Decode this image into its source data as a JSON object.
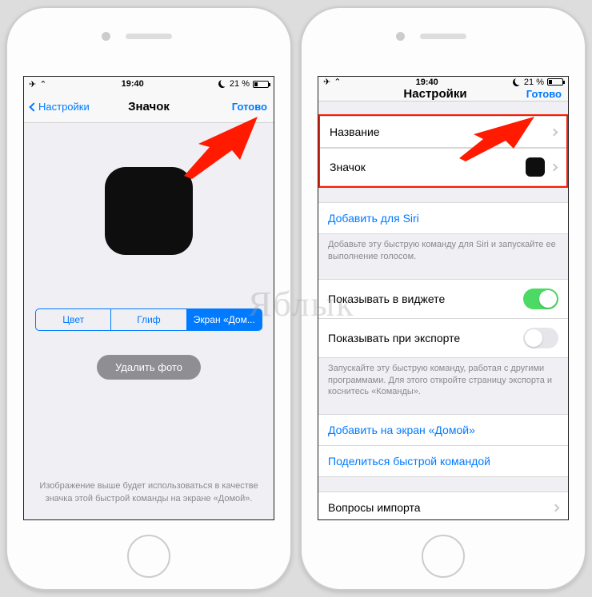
{
  "statusbar": {
    "time": "19:40",
    "battery": "21 %"
  },
  "left": {
    "nav": {
      "back": "Настройки",
      "title": "Значок",
      "done": "Готово"
    },
    "seg": {
      "color": "Цвет",
      "glyph": "Глиф",
      "home": "Экран «Дом..."
    },
    "delete": "Удалить фото",
    "note": "Изображение выше будет использоваться в качестве значка этой быстрой команды на экране «Домой»."
  },
  "right": {
    "nav": {
      "title": "Настройки",
      "done": "Готово"
    },
    "rows": {
      "name": "Название",
      "icon": "Значок",
      "addSiri": "Добавить для Siri",
      "siriNote": "Добавьте эту быструю команду для Siri и запускайте ее выполнение голосом.",
      "showWidget": "Показывать в виджете",
      "showExport": "Показывать при экспорте",
      "exportNote": "Запускайте эту быструю команду, работая с другими программами. Для этого откройте страницу экспорта и коснитесь «Команды».",
      "addHome": "Добавить на экран «Домой»",
      "share": "Поделиться быстрой командой",
      "import": "Вопросы импорта"
    }
  },
  "watermark": "Яблык"
}
